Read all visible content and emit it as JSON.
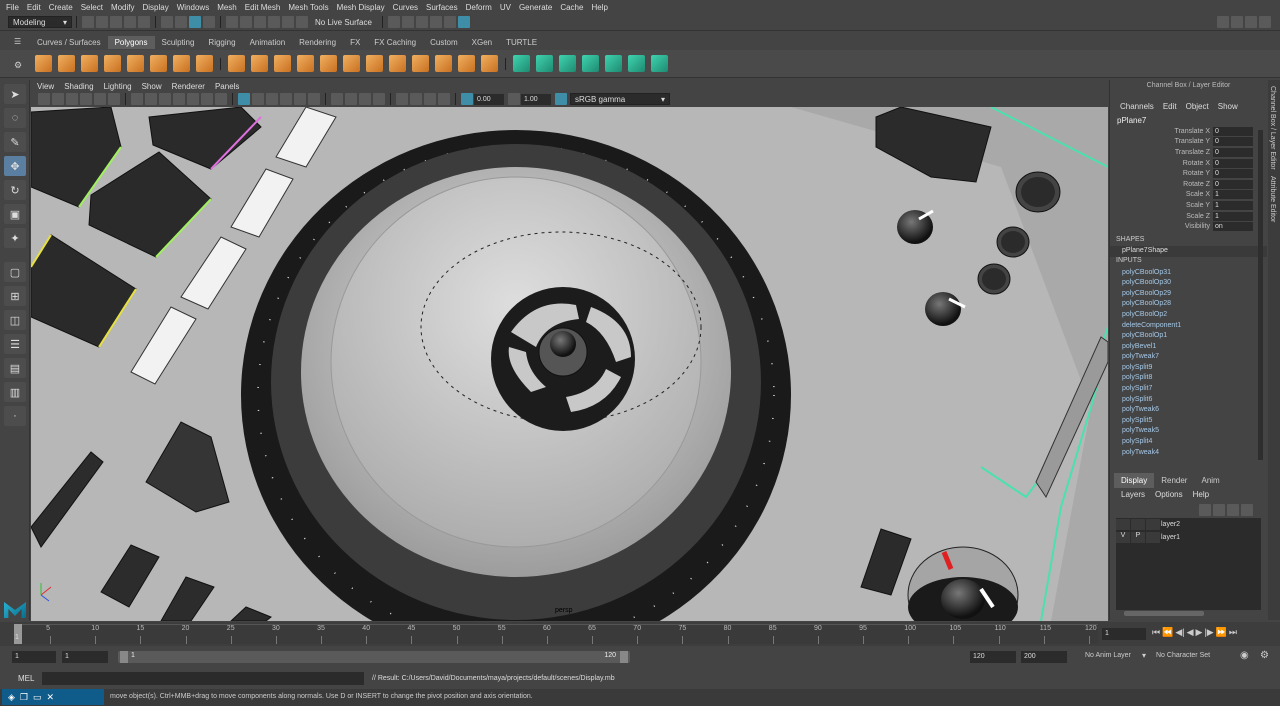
{
  "menubar": [
    "File",
    "Edit",
    "Create",
    "Select",
    "Modify",
    "Display",
    "Windows",
    "Mesh",
    "Edit Mesh",
    "Mesh Tools",
    "Mesh Display",
    "Curves",
    "Surfaces",
    "Deform",
    "UV",
    "Generate",
    "Cache",
    "Help"
  ],
  "statusline": {
    "workspace": "Modeling",
    "live_surface": "No Live Surface"
  },
  "shelf_tabs": [
    "Curves / Surfaces",
    "Polygons",
    "Sculpting",
    "Rigging",
    "Animation",
    "Rendering",
    "FX",
    "FX Caching",
    "Custom",
    "XGen",
    "TURTLE"
  ],
  "active_shelf": "Polygons",
  "panel_menu": [
    "View",
    "Shading",
    "Lighting",
    "Show",
    "Renderer",
    "Panels"
  ],
  "panel_toolbar": {
    "exposure": "0.00",
    "gamma": "1.00",
    "colorspace": "sRGB gamma"
  },
  "viewport": {
    "camera": "persp"
  },
  "channel_box": {
    "title": "Channel Box / Layer Editor",
    "menu": [
      "Channels",
      "Edit",
      "Object",
      "Show"
    ],
    "object": "pPlane7",
    "attributes": [
      {
        "name": "Translate X",
        "value": "0"
      },
      {
        "name": "Translate Y",
        "value": "0"
      },
      {
        "name": "Translate Z",
        "value": "0"
      },
      {
        "name": "Rotate X",
        "value": "0"
      },
      {
        "name": "Rotate Y",
        "value": "0"
      },
      {
        "name": "Rotate Z",
        "value": "0"
      },
      {
        "name": "Scale X",
        "value": "1"
      },
      {
        "name": "Scale Y",
        "value": "1"
      },
      {
        "name": "Scale Z",
        "value": "1"
      },
      {
        "name": "Visibility",
        "value": "on"
      }
    ],
    "shapes_label": "SHAPES",
    "shape": "pPlane7Shape",
    "inputs_label": "INPUTS",
    "inputs": [
      "polyCBoolOp31",
      "polyCBoolOp30",
      "polyCBoolOp29",
      "polyCBoolOp28",
      "polyCBoolOp2",
      "deleteComponent1",
      "polyCBoolOp1",
      "polyBevel1",
      "polyTweak7",
      "polySplit9",
      "polySplit8",
      "polySplit7",
      "polySplit6",
      "polyTweak6",
      "polySplit5",
      "polyTweak5",
      "polySplit4",
      "polyTweak4"
    ]
  },
  "display_tabs": [
    "Display",
    "Render",
    "Anim"
  ],
  "layers_menu": [
    "Layers",
    "Options",
    "Help"
  ],
  "layers": [
    {
      "v": "",
      "p": "",
      "name": "layer2"
    },
    {
      "v": "V",
      "p": "P",
      "name": "layer1"
    }
  ],
  "side_tabs": [
    "Channel Box / Layer Editor",
    "Attribute Editor"
  ],
  "timeline": {
    "ticks": [
      "5",
      "10",
      "15",
      "20",
      "25",
      "30",
      "35",
      "40",
      "45",
      "50",
      "55",
      "60",
      "65",
      "70",
      "75",
      "80",
      "85",
      "90",
      "95",
      "100",
      "105",
      "110",
      "115",
      "120"
    ],
    "start": "1",
    "current": "1"
  },
  "range": {
    "start": "1",
    "inner_start": "1",
    "range_start": "1",
    "range_end": "120",
    "end": "120",
    "max": "200",
    "anim_layer": "No Anim Layer",
    "char_set": "No Character Set"
  },
  "cmdline": {
    "lang": "MEL",
    "result": "// Result: C:/Users/David/Documents/maya/projects/default/scenes/Display.mb"
  },
  "helpline": "move object(s). Ctrl+MMB+drag to move components along normals. Use D or INSERT to change the pivot position and axis orientation."
}
